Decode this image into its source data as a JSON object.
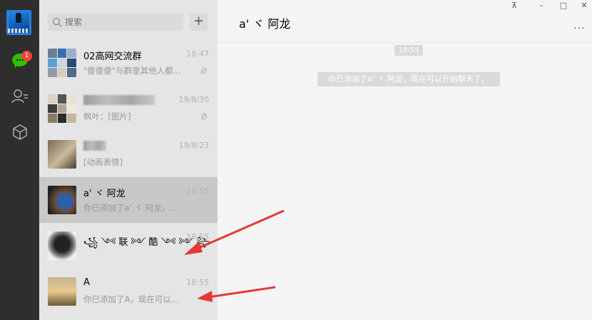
{
  "search": {
    "placeholder": "搜索"
  },
  "add_label": "+",
  "nav": {
    "badge": "1"
  },
  "chats": [
    {
      "name": "02高网交流群",
      "time": "18:47",
      "preview": "\"傻傻傻\"与群里其他人都...",
      "muted": true
    },
    {
      "name": "",
      "time": "19/8/30",
      "preview": "枫叶：[图片]",
      "muted": true
    },
    {
      "name": "",
      "time": "19/8/23",
      "preview": "[动画表情]",
      "muted": false
    },
    {
      "name": "a' ヾ 阿龙",
      "time": "18:55",
      "preview": "你已添加了a' ヾ 阿龙，...",
      "muted": false,
      "selected": true
    },
    {
      "name": "꧁ ༺ 联 ༻ 酷 ༺ ༻ ꧂",
      "time": "18:55",
      "preview": "",
      "muted": false
    },
    {
      "name": "A",
      "time": "18:55",
      "preview": "你已添加了A，现在可以...",
      "muted": false
    }
  ],
  "conversation": {
    "title": "a' ヾ 阿龙",
    "time_chip": "18:55",
    "system_message": "你已添加了a' ヾ 阿龙，现在可以开始聊天了。",
    "more": "..."
  },
  "window": {
    "pin": "⊼",
    "minimize": "–",
    "maximize": "□",
    "close": "✕"
  },
  "colors": {
    "nav_bg": "#2e2e2e",
    "list_bg": "#e6e5e5",
    "selected_bg": "#c9c8c8",
    "chat_bg": "#f5f5f5",
    "badge": "#f44336",
    "chat_green": "#2dc100",
    "arrow_red": "#e53935"
  }
}
